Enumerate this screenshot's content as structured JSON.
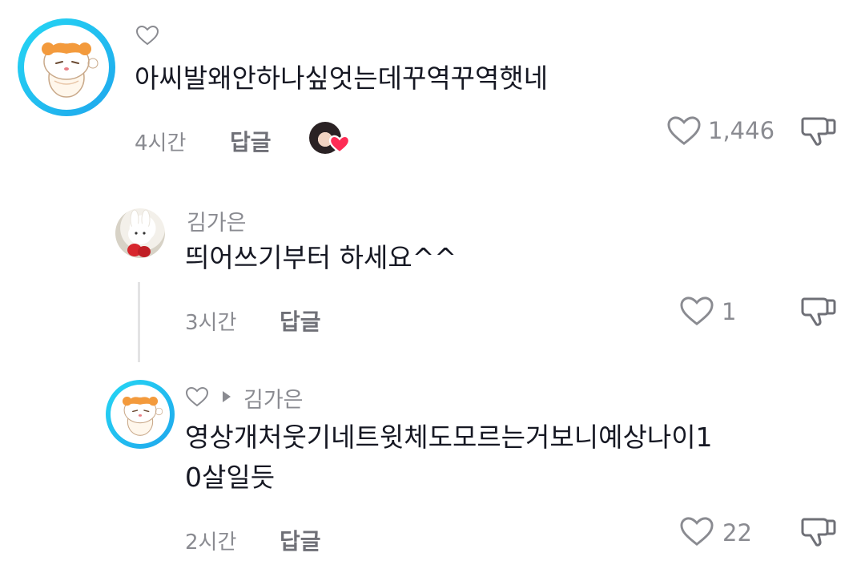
{
  "comments": [
    {
      "text": "아씨발왜안하나싶엇는데꾸역꾸역햇네",
      "time": "4시간",
      "reply_label": "답글",
      "like_count": "1,446",
      "icons": [
        "hamster-avatar-icon",
        "heart-outline-icon",
        "heart-icon",
        "thumbs-down-icon"
      ]
    }
  ],
  "replies": [
    {
      "username": "김가은",
      "text": "띄어쓰기부터 하세요^^",
      "time": "3시간",
      "reply_label": "답글",
      "like_count": "1",
      "icons": [
        "bunny-avatar-icon",
        "heart-icon",
        "thumbs-down-icon"
      ]
    },
    {
      "reply_to": "김가은",
      "text_line1": "영상개처웃기네트윗체도모르는거보니예상나이1",
      "text_line2": "0살일듯",
      "time": "2시간",
      "reply_label": "답글",
      "like_count": "22",
      "icons": [
        "hamster-avatar-icon",
        "heart-outline-icon",
        "play-arrow-icon",
        "heart-icon",
        "thumbs-down-icon"
      ]
    }
  ],
  "colors": {
    "avatar_ring": "#25d7f4",
    "liked_heart": "#fe2c55",
    "secondary_text": "#8a8b91"
  }
}
